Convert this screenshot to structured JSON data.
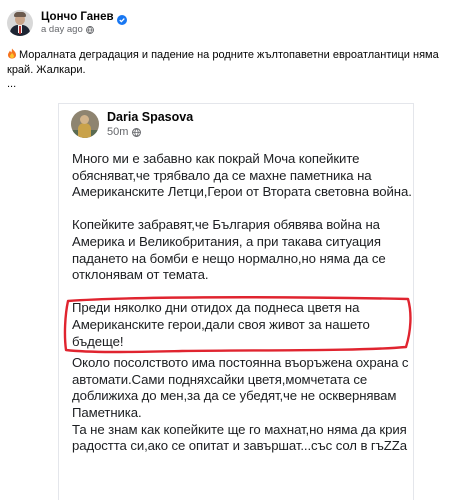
{
  "post": {
    "author": "Цончо Ганев",
    "time": "a day ago",
    "text": "Моралната деградация и падение на родните жълтопаветни евроатлантици няма край. Жалкари.",
    "ellipsis": "..."
  },
  "screenshot": {
    "author": "Daria Spasova",
    "time": "50m",
    "paragraphs": [
      "Много ми е забавно как покрай Моча копейките обясняват,че трябвало да се махне паметника на Американските Летци,Герои от Втората световна война.",
      "Копейките забравят,че България обявява война на Америка и Великобритания, а при такава ситуация падането на бомби е нещо нормално,но няма да се отклонявам от темата.",
      "Преди няколко дни отидох да поднеса цветя на Американските герои,дали своя живот за нашето бъдеще!",
      "Около посолството има постоянна въоръжена охрана с автомати.Сами подняхсайки цветя,момчетата се доближиха до мен,за да се убедят,че не осквернявам Паметника.",
      "Та не знам как копейките ще го махнат,но няма да крия радостта си,ако се опитат и завършат...със сол в гъZZа"
    ]
  },
  "colors": {
    "verified": "#1877f2",
    "highlight": "#e0242f",
    "meta": "#65676b"
  },
  "icons": [
    "verified-badge-icon",
    "globe-icon",
    "fire-icon"
  ]
}
